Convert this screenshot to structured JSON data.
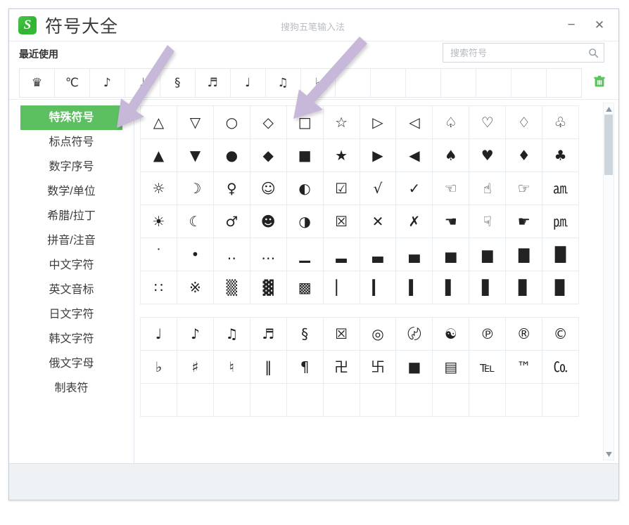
{
  "window": {
    "app_title": "符号大全",
    "ime_title": "搜狗五笔输入法",
    "logo_letter": "S",
    "minimize_label": "−",
    "close_label": "✕",
    "accent_color": "#5cbf60",
    "arrow_color": "#c3b4d6"
  },
  "recent": {
    "label": "最近使用",
    "clear_tooltip": "清空",
    "symbols": [
      "♛",
      "℃",
      "♪",
      "♩",
      "§",
      "♬",
      "♩",
      "♫",
      "♭",
      "",
      "",
      "",
      "",
      "",
      "",
      ""
    ]
  },
  "search": {
    "placeholder": "搜索符号",
    "value": "",
    "icon": "search-icon"
  },
  "sidebar": {
    "items": [
      {
        "label": "特殊符号",
        "selected": true
      },
      {
        "label": "标点符号",
        "selected": false
      },
      {
        "label": "数字序号",
        "selected": false
      },
      {
        "label": "数学/单位",
        "selected": false
      },
      {
        "label": "希腊/拉丁",
        "selected": false
      },
      {
        "label": "拼音/注音",
        "selected": false
      },
      {
        "label": "中文字符",
        "selected": false
      },
      {
        "label": "英文音标",
        "selected": false
      },
      {
        "label": "日文字符",
        "selected": false
      },
      {
        "label": "韩文字符",
        "selected": false
      },
      {
        "label": "俄文字母",
        "selected": false
      },
      {
        "label": "制表符",
        "selected": false
      }
    ]
  },
  "panel": {
    "blocks": [
      {
        "rows": [
          [
            "△",
            "▽",
            "○",
            "◇",
            "□",
            "☆",
            "▷",
            "◁",
            "♤",
            "♡",
            "♢",
            "♧"
          ],
          [
            "▲",
            "▼",
            "●",
            "◆",
            "■",
            "★",
            "▶",
            "◀",
            "♠",
            "♥",
            "♦",
            "♣"
          ],
          [
            "☼",
            "☽",
            "♀",
            "☺",
            "◐",
            "☑",
            "√",
            "✓",
            "☜",
            "☝",
            "☞",
            "㏂"
          ],
          [
            "☀",
            "☾",
            "♂",
            "☻",
            "◑",
            "☒",
            "✕",
            "✗",
            "☚",
            "☟",
            "☛",
            "㏘"
          ],
          [
            "˙",
            "•",
            "‥",
            "…",
            "▁",
            "▂",
            "▃",
            "▄",
            "▅",
            "▆",
            "▇",
            "█"
          ],
          [
            "∷",
            "※",
            "▒",
            "▓",
            "▩",
            "▏",
            "▎",
            "▍",
            "▌",
            "▋",
            "▊",
            "▉"
          ]
        ]
      },
      {
        "rows": [
          [
            "♩",
            "♪",
            "♫",
            "♬",
            "§",
            "☒",
            "◎",
            "〄",
            "☯",
            "℗",
            "®",
            "©"
          ],
          [
            "♭",
            "♯",
            "♮",
            "‖",
            "¶",
            "卍",
            "卐",
            "■",
            "▤",
            "℡",
            "™",
            "㏇"
          ],
          [
            "",
            "",
            "",
            "",
            "",
            "",
            "",
            "",
            "",
            "",
            "",
            ""
          ]
        ]
      }
    ]
  },
  "scrollbar": {
    "up_arrow": "▲",
    "down_arrow": "▼",
    "position": "top"
  },
  "annotations": {
    "arrow_1_target": "特殊符号",
    "arrow_2_target": "▼"
  }
}
